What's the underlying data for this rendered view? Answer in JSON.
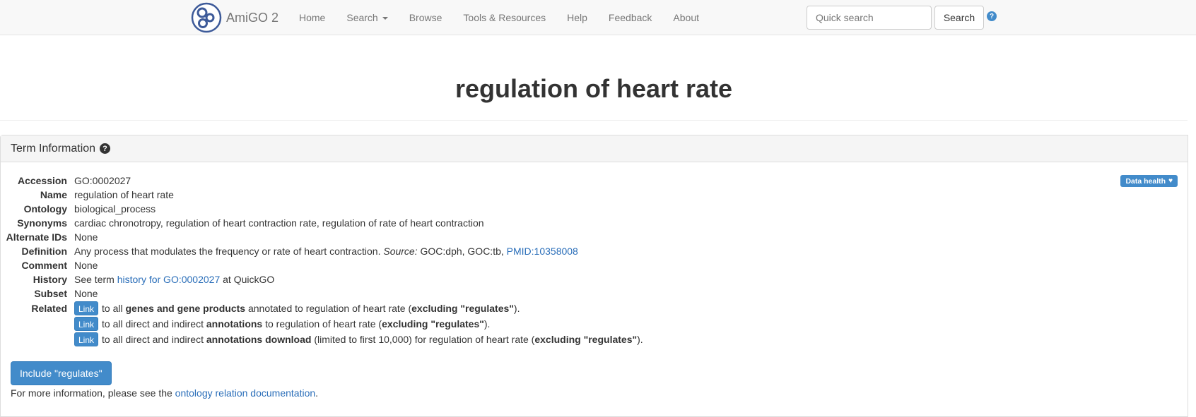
{
  "navbar": {
    "brand": "AmiGO 2",
    "links": [
      "Home",
      "Search",
      "Browse",
      "Tools & Resources",
      "Help",
      "Feedback",
      "About"
    ],
    "search_placeholder": "Quick search",
    "search_button": "Search",
    "help_glyph": "?"
  },
  "page_title": "regulation of heart rate",
  "panel": {
    "title": "Term Information",
    "help_glyph": "?",
    "badge": "Data health",
    "heart_glyph": "♥"
  },
  "term": {
    "accession": {
      "label": "Accession",
      "value": "GO:0002027"
    },
    "name": {
      "label": "Name",
      "value": "regulation of heart rate"
    },
    "ontology": {
      "label": "Ontology",
      "value": "biological_process"
    },
    "synonyms": {
      "label": "Synonyms",
      "value": "cardiac chronotropy, regulation of heart contraction rate, regulation of rate of heart contraction"
    },
    "alternate_ids": {
      "label": "Alternate IDs",
      "value": "None"
    },
    "definition": {
      "label": "Definition",
      "text": "Any process that modulates the frequency or rate of heart contraction.",
      "source_label": "Source:",
      "source_text": "GOC:dph, GOC:tb,",
      "pmid": "PMID:10358008"
    },
    "comment": {
      "label": "Comment",
      "value": "None"
    },
    "history": {
      "label": "History",
      "pre": "See term",
      "link": "history for GO:0002027",
      "post": "at QuickGO"
    },
    "subset": {
      "label": "Subset",
      "value": "None"
    },
    "related": {
      "label": "Related",
      "link_label": "Link",
      "rows": [
        {
          "pre": "to all",
          "bold": "genes and gene products",
          "mid": "annotated to regulation of heart rate (",
          "excl": "excluding \"regulates\"",
          "post": ")."
        },
        {
          "pre": "to all direct and indirect",
          "bold": "annotations",
          "mid": "to regulation of heart rate (",
          "excl": "excluding \"regulates\"",
          "post": ")."
        },
        {
          "pre": "to all direct and indirect",
          "bold": "annotations download",
          "mid": "(limited to first 10,000) for regulation of heart rate (",
          "excl": "excluding \"regulates\"",
          "post": ")."
        }
      ]
    }
  },
  "include_button": "Include \"regulates\"",
  "more_info": {
    "pre": "For more information, please see the",
    "link": "ontology relation documentation",
    "post": "."
  }
}
